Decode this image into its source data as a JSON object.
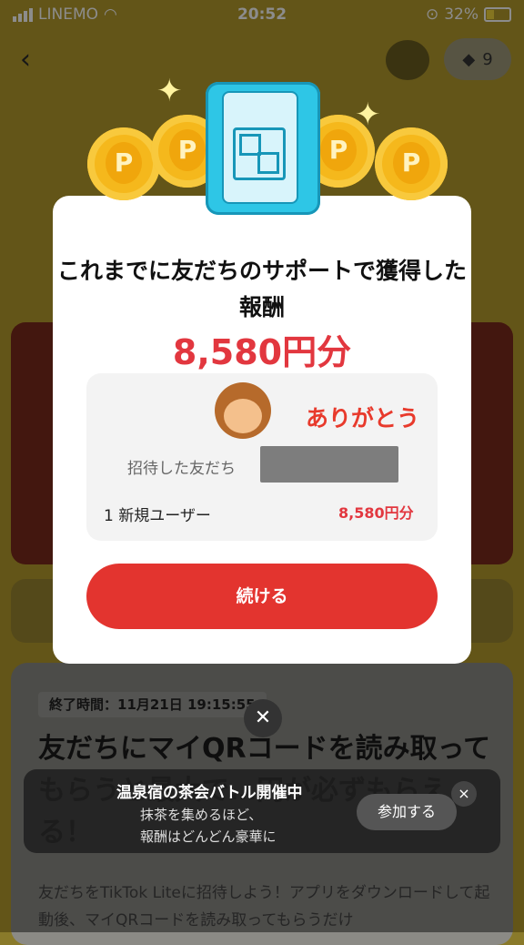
{
  "status_bar": {
    "carrier": "LINEMO",
    "time": "20:52",
    "battery": "32%"
  },
  "header": {
    "ticket_count": "9"
  },
  "background": {
    "end_time_label": "終了時間：11月21日 19:15:55",
    "headline": "友だちにマイQRコードを読み取ってもらうと最大で…円が必ずもらえる！",
    "body": "友だちをTikTok Liteに招待しよう！アプリをダウンロードして起動後、マイQRコードを読み取ってもらうだけ"
  },
  "banner": {
    "title": "温泉宿の茶会バトル開催中",
    "line1": "抹茶を集めるほど、",
    "line2": "報酬はどんどん豪華に",
    "join_label": "参加する",
    "close_glyph": "×"
  },
  "modal": {
    "title": "これまでに友だちのサポートで獲得した報酬",
    "amount": "8,580円分",
    "thanks": "ありがとう",
    "invited_label": "招待した友だち",
    "new_user_label": "1 新規ユーザー",
    "new_user_amount": "8,580円分",
    "continue_label": "続ける",
    "close_glyph": "✕",
    "coin_letter": "P"
  },
  "colors": {
    "accent_red": "#e3342f",
    "amount_red": "#e2373f",
    "phone_blue": "#2ec6e6",
    "coin_gold": "#f5b81c"
  }
}
